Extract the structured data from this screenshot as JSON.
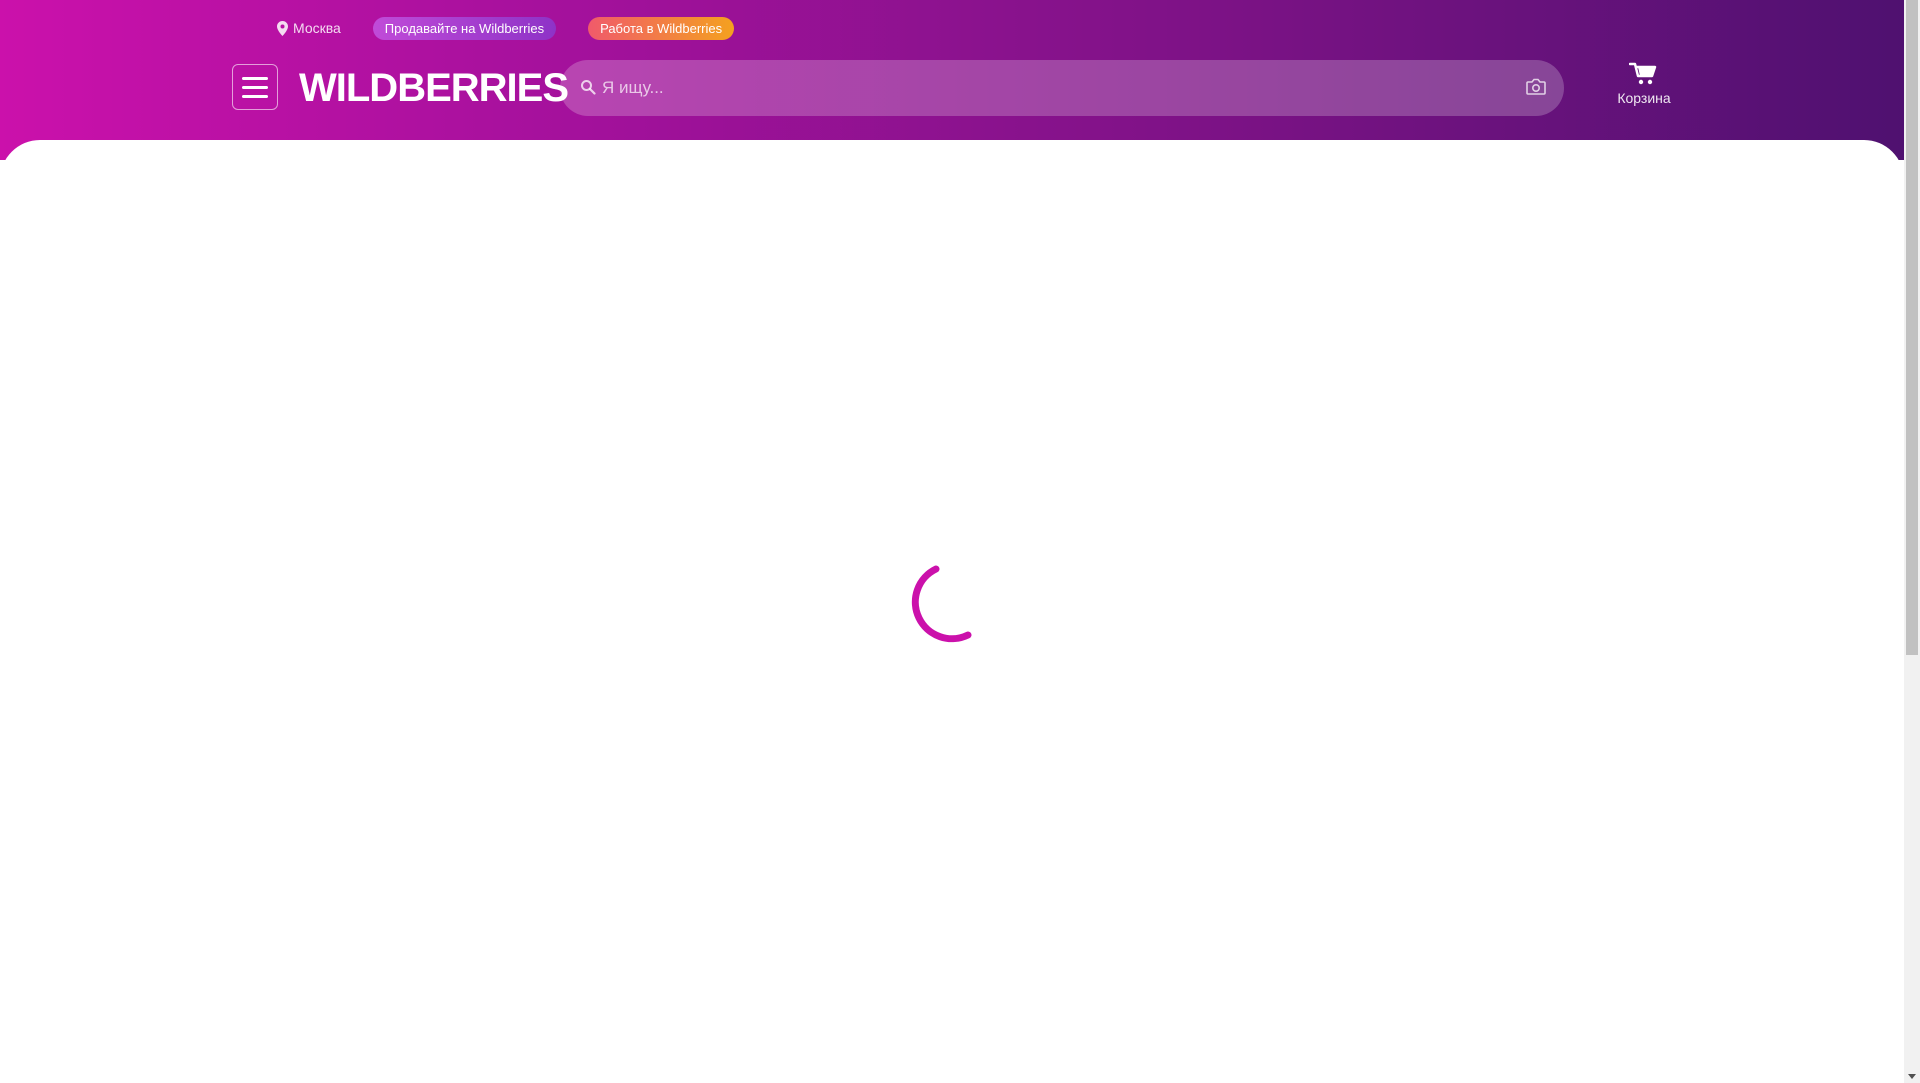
{
  "header": {
    "location": "Москва",
    "sell_label": "Продавайте на Wildberries",
    "job_label": "Работа в Wildberries",
    "logo": "WILDBERRIES",
    "cart_label": "Корзина"
  },
  "search": {
    "placeholder": "Я ищу..."
  },
  "icons": {
    "menu": "menu-icon",
    "location": "location-pin-icon",
    "search": "search-icon",
    "camera": "camera-icon",
    "cart": "cart-icon",
    "loading": "loading-spinner"
  },
  "colors": {
    "brand_start": "#cb11ab",
    "brand_end": "#4f1170",
    "spinner": "#cb11ab",
    "job_pill_start": "#f05a6b",
    "job_pill_end": "#f4a11f",
    "sell_pill": "#a43fd0"
  }
}
